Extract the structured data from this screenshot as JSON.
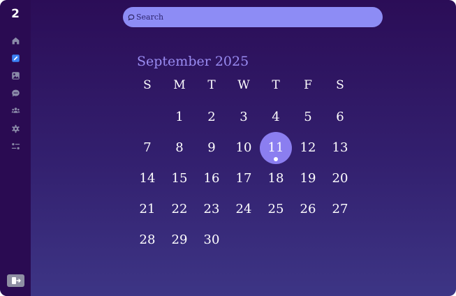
{
  "app": {
    "logo_text": "2"
  },
  "sidebar": {
    "items": [
      {
        "name": "home",
        "icon": "home-icon",
        "color": "#8a8aa8"
      },
      {
        "name": "calendar",
        "icon": "pencil-square-icon",
        "color": "#3b82f6"
      },
      {
        "name": "gallery",
        "icon": "image-icon",
        "color": "#8a8aa8"
      },
      {
        "name": "chat",
        "icon": "chat-bubble-icon",
        "color": "#8a8aa8"
      },
      {
        "name": "people",
        "icon": "users-icon",
        "color": "#8a8aa8"
      },
      {
        "name": "settings",
        "icon": "gear-icon",
        "color": "#8a8aa8"
      },
      {
        "name": "controls",
        "icon": "sliders-icon",
        "color": "#8a8aa8"
      }
    ],
    "logout_icon": "logout-icon"
  },
  "search": {
    "placeholder": "Search",
    "value": ""
  },
  "calendar": {
    "month_label": "September 2025",
    "weekdays": [
      "S",
      "M",
      "T",
      "W",
      "T",
      "F",
      "S"
    ],
    "weeks": [
      [
        "",
        "1",
        "2",
        "3",
        "4",
        "5",
        "6"
      ],
      [
        "7",
        "8",
        "9",
        "10",
        "11",
        "12",
        "13"
      ],
      [
        "14",
        "15",
        "16",
        "17",
        "18",
        "19",
        "20"
      ],
      [
        "21",
        "22",
        "23",
        "24",
        "25",
        "26",
        "27"
      ],
      [
        "28",
        "29",
        "30",
        "",
        "",
        "",
        ""
      ]
    ],
    "selected_day": "11",
    "selected_color": "#8b7ef0",
    "accent_color": "#9a8cf2"
  }
}
